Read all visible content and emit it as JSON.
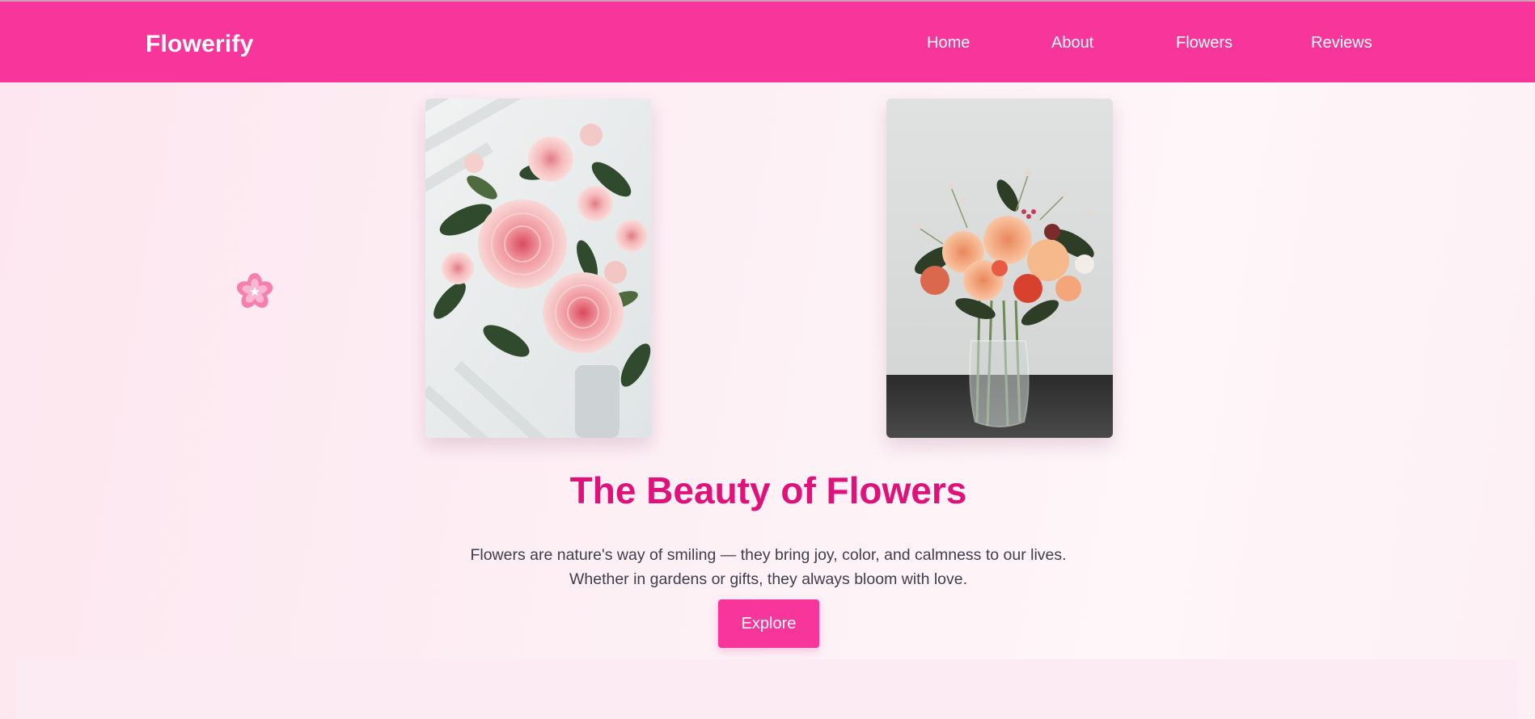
{
  "header": {
    "brand": "Flowerify",
    "nav": [
      {
        "label": "Home"
      },
      {
        "label": "About"
      },
      {
        "label": "Flowers"
      },
      {
        "label": "Reviews"
      }
    ]
  },
  "gallery": {
    "images": [
      {
        "icon": "pink-roses-bouquet-photo"
      },
      {
        "icon": "mixed-flowers-vase-photo"
      }
    ],
    "decoration_icon": "cherry-blossom-icon"
  },
  "hero": {
    "title": "The Beauty of Flowers",
    "text": "Flowers are nature's way of smiling — they bring joy, color, and calmness to our lives. Whether in gardens or gifts, they always bloom with love.",
    "button_label": "Explore"
  },
  "colors": {
    "brand": "#f7359b",
    "title": "#e0127a",
    "text": "#3d3f4e",
    "background": "#fdeef4"
  }
}
